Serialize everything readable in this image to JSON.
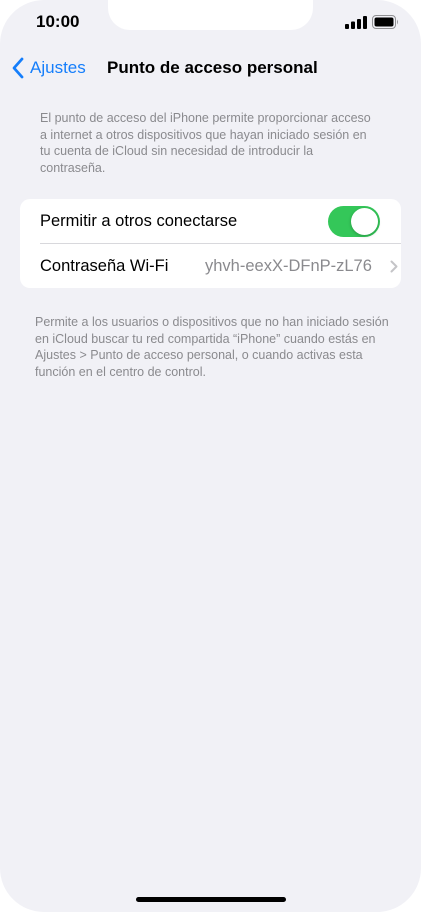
{
  "status_bar": {
    "time": "10:00"
  },
  "nav": {
    "back_label": "Ajustes",
    "title": "Punto de acceso personal"
  },
  "description_top": "El punto de acceso del iPhone permite proporcionar acceso a internet a otros dispositivos que hayan iniciado sesión en tu cuenta de iCloud sin necesidad de introducir la contraseña.",
  "settings": {
    "allow_others": {
      "label": "Permitir a otros conectarse",
      "enabled": true
    },
    "wifi_password": {
      "label": "Contraseña Wi-Fi",
      "value": "yhvh-eexX-DFnP-zL76"
    }
  },
  "description_bottom": "Permite a los usuarios o dispositivos que no han iniciado sesión en iCloud buscar tu red compartida “iPhone” cuando estás en Ajustes > Punto de acceso personal, o cuando activas esta función en el centro de control.",
  "colors": {
    "accent": "#157efb",
    "toggle_on": "#34c759",
    "background": "#f1f1f6",
    "secondary_text": "#8a8a8e"
  },
  "icons": {
    "back": "chevron-left-icon",
    "disclosure": "chevron-right-icon",
    "signal": "cellular-signal-icon",
    "battery": "battery-icon"
  }
}
